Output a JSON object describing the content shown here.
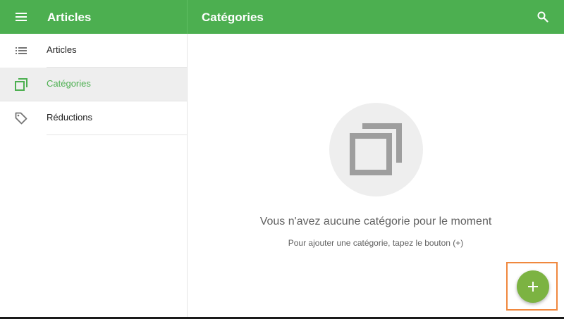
{
  "appbar": {
    "section_title": "Articles",
    "page_title": "Catégories",
    "menu_icon": "menu-icon",
    "search_icon": "search-icon"
  },
  "sidebar": {
    "items": [
      {
        "label": "Articles",
        "icon": "list-icon",
        "selected": false
      },
      {
        "label": "Catégories",
        "icon": "categories-icon",
        "selected": true
      },
      {
        "label": "Réductions",
        "icon": "tag-icon",
        "selected": false
      }
    ]
  },
  "main": {
    "empty_title": "Vous n'avez aucune catégorie pour le moment",
    "empty_hint": "Pour ajouter une catégorie, tapez le bouton (+)",
    "empty_icon": "categories-icon"
  },
  "fab": {
    "label": "+",
    "icon": "plus-icon"
  },
  "colors": {
    "primary": "#4caf50",
    "fab": "#7cb342",
    "selected_bg": "#eeeeee",
    "highlight": "#f0883e"
  }
}
